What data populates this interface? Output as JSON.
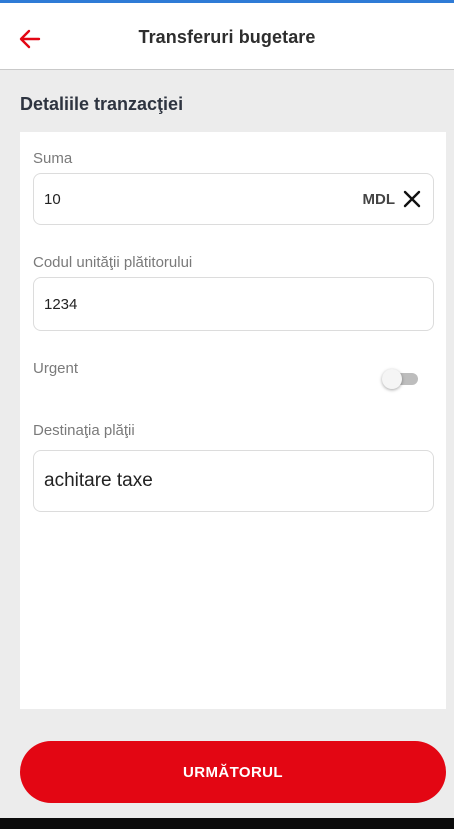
{
  "header": {
    "title": "Transferuri bugetare",
    "back_icon": "arrow-left-icon",
    "accent_color": "#e30613"
  },
  "section": {
    "title": "Detaliile tranzacţiei"
  },
  "form": {
    "amount": {
      "label": "Suma",
      "value": "10",
      "currency": "MDL",
      "clear_icon": "close-icon"
    },
    "payer_unit_code": {
      "label": "Codul unităţii plătitorului",
      "value": "1234"
    },
    "urgent": {
      "label": "Urgent",
      "enabled": false
    },
    "payment_destination": {
      "label": "Destinaţia plăţii",
      "value": "achitare taxe"
    }
  },
  "footer": {
    "next_label": "URMĂTORUL"
  }
}
